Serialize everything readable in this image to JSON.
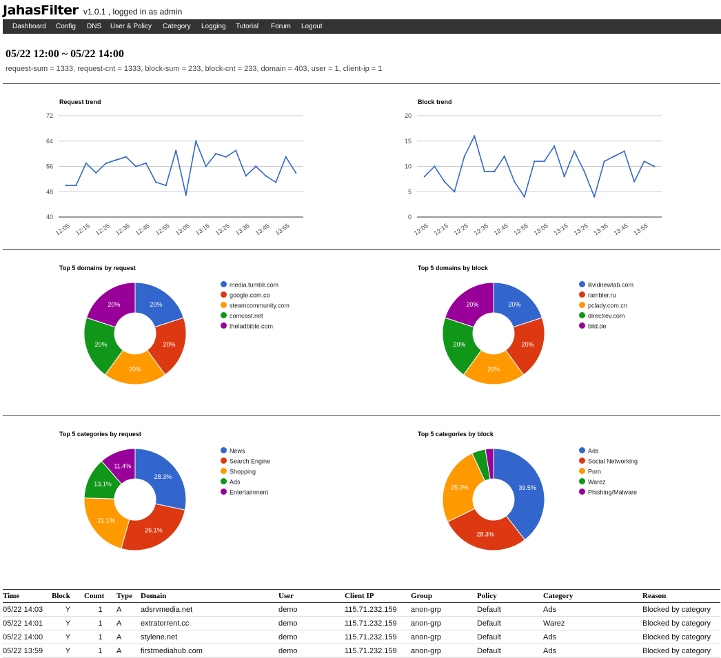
{
  "app": {
    "name": "JahasFilter",
    "version_text": "v1.0.1 , logged in as admin"
  },
  "nav": [
    {
      "label": "Dashboard"
    },
    {
      "label": "Config"
    },
    {
      "label": "DNS"
    },
    {
      "label": "User & Policy"
    },
    {
      "label": "Category"
    },
    {
      "label": "Logging"
    },
    {
      "label": "Tutorial"
    },
    {
      "label": "Forum"
    },
    {
      "label": "Logout"
    }
  ],
  "summary": {
    "period": "05/22 12:00 ~ 05/22 14:00",
    "stats": "request-sum = 1333, request-cnt = 1333, block-sum = 233, block-cnt = 233, domain = 403, user = 1, client-ip = 1"
  },
  "chart_data": [
    {
      "type": "line",
      "title": "Request trend",
      "x": [
        "12:05",
        "12:10",
        "12:15",
        "12:20",
        "12:25",
        "12:30",
        "12:35",
        "12:40",
        "12:45",
        "12:50",
        "12:55",
        "13:00",
        "13:05",
        "13:10",
        "13:15",
        "13:20",
        "13:25",
        "13:30",
        "13:35",
        "13:40",
        "13:45",
        "13:50",
        "13:55",
        "14:00",
        "14:05"
      ],
      "xticks": [
        "12:05",
        "12:15",
        "12:25",
        "12:35",
        "12:45",
        "12:55",
        "13:05",
        "13:15",
        "13:25",
        "13:35",
        "13:45",
        "13:55"
      ],
      "values": [
        50,
        50,
        57,
        54,
        57,
        58,
        59,
        56,
        57,
        51,
        50,
        61,
        47,
        64,
        56,
        60,
        59,
        61,
        53,
        56,
        53,
        51,
        59,
        54
      ],
      "ylim": [
        40,
        72
      ],
      "yticks": [
        40,
        48,
        56,
        64,
        72
      ],
      "color": "#3366cc",
      "grid": true
    },
    {
      "type": "line",
      "title": "Block trend",
      "x": [
        "12:05",
        "12:10",
        "12:15",
        "12:20",
        "12:25",
        "12:30",
        "12:35",
        "12:40",
        "12:45",
        "12:50",
        "12:55",
        "13:00",
        "13:05",
        "13:10",
        "13:15",
        "13:20",
        "13:25",
        "13:30",
        "13:35",
        "13:40",
        "13:45",
        "13:50",
        "13:55",
        "14:00"
      ],
      "xticks": [
        "12:05",
        "12:15",
        "12:25",
        "12:35",
        "12:45",
        "12:55",
        "13:05",
        "13:15",
        "13:25",
        "13:35",
        "13:45",
        "13:55"
      ],
      "values": [
        8,
        10,
        7,
        5,
        12,
        16,
        9,
        9,
        12,
        7,
        4,
        11,
        11,
        14,
        8,
        13,
        9,
        4,
        11,
        12,
        13,
        7,
        11,
        10
      ],
      "ylim": [
        0,
        20
      ],
      "yticks": [
        0,
        5,
        10,
        15,
        20
      ],
      "color": "#3366cc",
      "grid": true
    },
    {
      "type": "pie",
      "title": "Top 5 domains by request",
      "labels": [
        "media.tumblr.com",
        "google.com.co",
        "steamcommunity.com",
        "comcast.net",
        "theladbible.com"
      ],
      "values": [
        20,
        20,
        20,
        20,
        20
      ],
      "value_labels": [
        "20%",
        "20%",
        "20%",
        "20%",
        "20%"
      ],
      "colors": [
        "#3366cc",
        "#dc3912",
        "#ff9900",
        "#109618",
        "#990099"
      ],
      "legend": "right"
    },
    {
      "type": "pie",
      "title": "Top 5 domains by block",
      "labels": [
        "ilividnewtab.com",
        "rambler.ru",
        "pclady.com.cn",
        "directrev.com",
        "bild.de"
      ],
      "values": [
        20,
        20,
        20,
        20,
        20
      ],
      "value_labels": [
        "20%",
        "20%",
        "20%",
        "20%",
        "20%"
      ],
      "colors": [
        "#3366cc",
        "#dc3912",
        "#ff9900",
        "#109618",
        "#990099"
      ],
      "legend": "right"
    },
    {
      "type": "pie",
      "title": "Top 5 categories by request",
      "labels": [
        "News",
        "Search Engine",
        "Shopping",
        "Ads",
        "Entertainment"
      ],
      "values": [
        28.3,
        26.1,
        21.1,
        13.1,
        11.4
      ],
      "value_labels": [
        "28.3%",
        "26.1%",
        "21.1%",
        "13.1%",
        "11.4%"
      ],
      "colors": [
        "#3366cc",
        "#dc3912",
        "#ff9900",
        "#109618",
        "#990099"
      ],
      "legend": "right"
    },
    {
      "type": "pie",
      "title": "Top 5 categories by block",
      "labels": [
        "Ads",
        "Social Networking",
        "Porn",
        "Warez",
        "Phishing/Malware"
      ],
      "values": [
        39.5,
        28.3,
        25.3,
        4.3,
        2.6
      ],
      "value_labels": [
        "39.5%",
        "28.3%",
        "25.3%",
        "",
        ""
      ],
      "colors": [
        "#3366cc",
        "#dc3912",
        "#ff9900",
        "#109618",
        "#990099"
      ],
      "legend": "right"
    }
  ],
  "log": {
    "columns": [
      "Time",
      "Block",
      "Count",
      "Type",
      "Domain",
      "User",
      "Client IP",
      "Group",
      "Policy",
      "Category",
      "Reason"
    ],
    "rows": [
      [
        "05/22 14:03",
        "Y",
        "1",
        "A",
        "adsrvmedia.net",
        "demo",
        "115.71.232.159",
        "anon-grp",
        "Default",
        "Ads",
        "Blocked by category"
      ],
      [
        "05/22 14:01",
        "Y",
        "1",
        "A",
        "extratorrent.cc",
        "demo",
        "115.71.232.159",
        "anon-grp",
        "Default",
        "Warez",
        "Blocked by category"
      ],
      [
        "05/22 14:00",
        "Y",
        "1",
        "A",
        "stylene.net",
        "demo",
        "115.71.232.159",
        "anon-grp",
        "Default",
        "Ads",
        "Blocked by category"
      ],
      [
        "05/22 13:59",
        "Y",
        "1",
        "A",
        "firstmediahub.com",
        "demo",
        "115.71.232.159",
        "anon-grp",
        "Default",
        "Ads",
        "Blocked by category"
      ]
    ]
  }
}
